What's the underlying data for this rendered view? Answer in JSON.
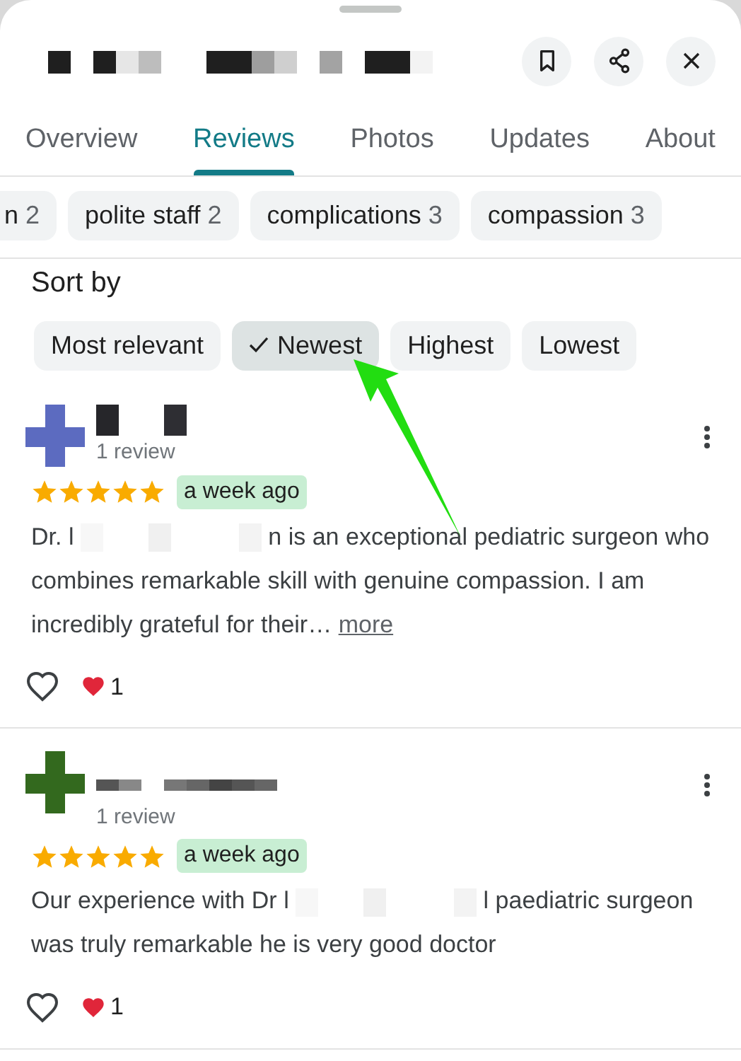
{
  "header": {
    "title": {
      "kind": "redacted"
    }
  },
  "tabs": [
    {
      "label": "Overview",
      "selected": false
    },
    {
      "label": "Reviews",
      "selected": true
    },
    {
      "label": "Photos",
      "selected": false
    },
    {
      "label": "Updates",
      "selected": false
    },
    {
      "label": "About",
      "selected": false
    }
  ],
  "topics": [
    {
      "label": "n",
      "count": "2"
    },
    {
      "label": "polite staff",
      "count": "2"
    },
    {
      "label": "complications",
      "count": "3"
    },
    {
      "label": "compassion",
      "count": "3"
    }
  ],
  "sort": {
    "label": "Sort by",
    "options": [
      {
        "label": "Most relevant",
        "selected": false
      },
      {
        "label": "Newest",
        "selected": true
      },
      {
        "label": "Highest",
        "selected": false
      },
      {
        "label": "Lowest",
        "selected": false
      }
    ]
  },
  "reviews": [
    {
      "name": {
        "kind": "redacted"
      },
      "review_count": "1 review",
      "stars": 5,
      "time": "a week ago",
      "body": [
        {
          "kind": "text",
          "text": "Dr. l"
        },
        {
          "kind": "redacted"
        },
        {
          "kind": "text",
          "text": "n is an exceptional pediatric surgeon who combines remarkable skill with genuine compassion. I am incredibly grateful for their…"
        }
      ],
      "more": "more",
      "likes": "1"
    },
    {
      "name": {
        "kind": "redacted"
      },
      "review_count": "1 review",
      "stars": 5,
      "time": "a week ago",
      "body": [
        {
          "kind": "text",
          "text": "Our experience with Dr l"
        },
        {
          "kind": "redacted"
        },
        {
          "kind": "text",
          "text": "l  paediatric surgeon was truly remarkable he is very good doctor"
        }
      ],
      "likes": "1"
    }
  ]
}
